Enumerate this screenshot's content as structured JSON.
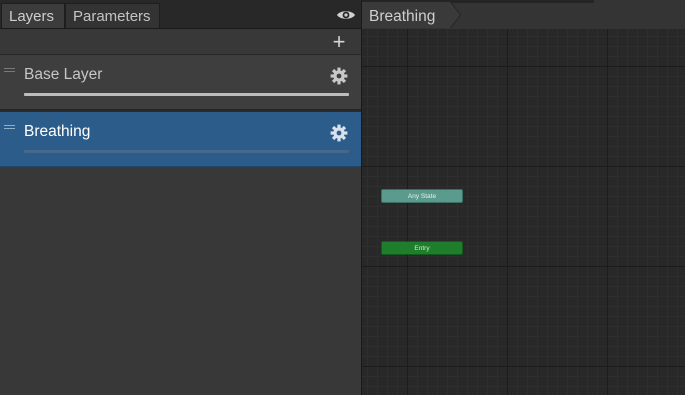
{
  "tabs": [
    {
      "label": "Layers",
      "active": true
    },
    {
      "label": "Parameters",
      "active": false
    }
  ],
  "icons": {
    "visibility": "eye-icon",
    "add": "plus-icon",
    "settings": "gear-icon",
    "drag": "drag-handle-icon"
  },
  "toolbar": {
    "add_label": "+"
  },
  "layers": [
    {
      "name": "Base Layer",
      "selected": false,
      "weight": 1.0
    },
    {
      "name": "Breathing",
      "selected": true,
      "weight": 0.0
    }
  ],
  "breadcrumb": {
    "items": [
      "Breathing"
    ]
  },
  "graph": {
    "nodes": [
      {
        "label": "Any State",
        "color": "#5a9b8d"
      },
      {
        "label": "Entry",
        "color": "#1f7e2c"
      }
    ]
  },
  "colors": {
    "selection": "#2c5d8a",
    "panel": "#383838",
    "graph_background": "#282828"
  }
}
